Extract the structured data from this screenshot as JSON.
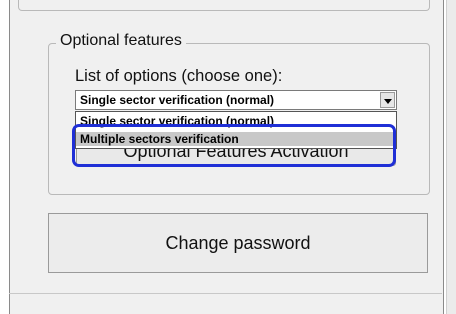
{
  "optional_features": {
    "legend": "Optional features",
    "list_label": "List of options (choose one):",
    "selected_value": "Single sector verification (normal)",
    "options": [
      "Single sector verification (normal)",
      "Multiple sectors verification"
    ],
    "activation_button_label": "Optional Features Activation"
  },
  "change_password_label": "Change password",
  "colors": {
    "highlight": "#1f2fd6",
    "panel": "#f0f0f0"
  },
  "icons": {
    "dropdown_arrow": "chevron-down-icon"
  }
}
